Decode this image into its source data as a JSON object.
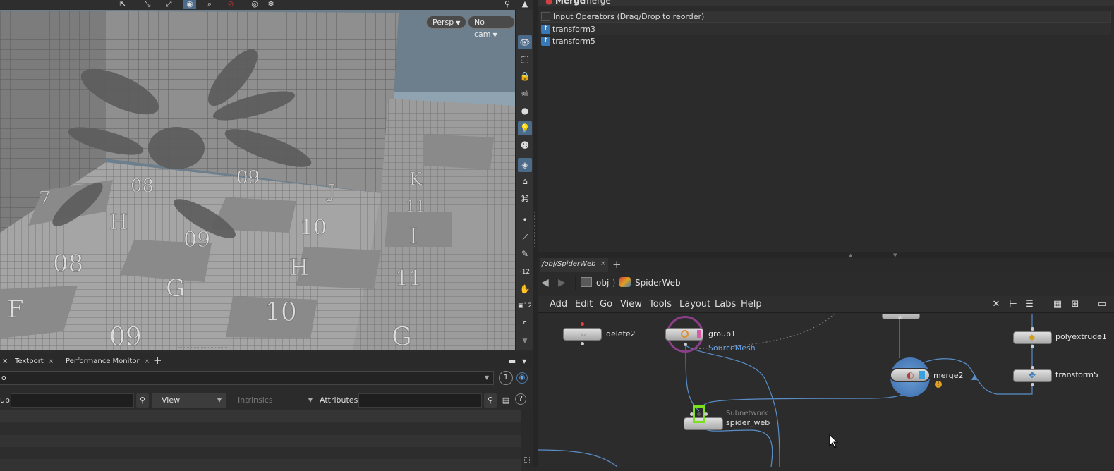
{
  "viewport": {
    "persp_label": "Persp",
    "cam_label": "No cam",
    "floor_labels": [
      "08",
      "09",
      "J",
      "K",
      "11",
      "H",
      "10",
      "I",
      "08",
      "09",
      "H",
      "11",
      "G",
      "10",
      "F",
      "09",
      "G",
      "7"
    ]
  },
  "bottom_left": {
    "tabs": [
      {
        "label": "Textport"
      },
      {
        "label": "Performance Monitor"
      }
    ],
    "path_text": "o",
    "page_number": "1",
    "group_label": "up:",
    "view_label": "View",
    "intrinsics_label": "Intrinsics",
    "attributes_label": "Attributes:"
  },
  "params": {
    "header_type": "Merge",
    "header_name": "merge",
    "ops_header": "Input Operators (Drag/Drop to reorder)",
    "ops": [
      "transform3",
      "transform5"
    ]
  },
  "network": {
    "tab_path": "/obj/SpiderWeb",
    "crumbs": [
      "obj",
      "SpiderWeb"
    ],
    "menus": [
      "Add",
      "Edit",
      "Go",
      "View",
      "Tools",
      "Layout",
      "Labs",
      "Help"
    ],
    "nodes": {
      "delete2": "delete2",
      "group1": "group1",
      "group1_sub": "SourceMesh",
      "merge2": "merge2",
      "polyextrude1": "polyextrude1",
      "transform5": "transform5",
      "spider_web": "spider_web",
      "spider_web_sub": "Subnetwork"
    }
  },
  "colors": {
    "accent_blue": "#3a79b8",
    "wire": "#5a8ec8",
    "group_ring": "#8a3f88",
    "select_green": "#7be11c",
    "warning": "#e0a020"
  }
}
